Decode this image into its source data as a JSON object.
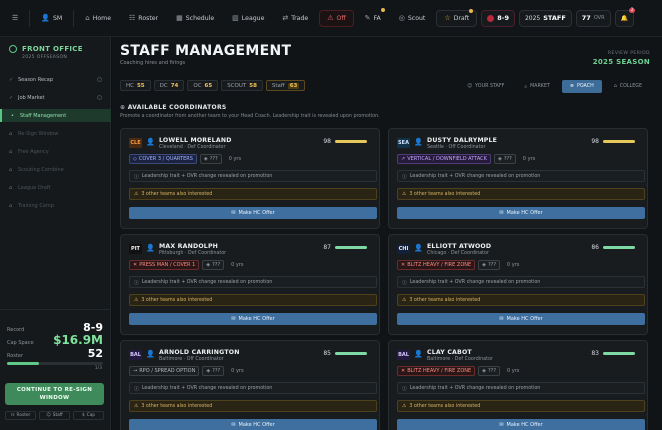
{
  "nav": {
    "user": "SM",
    "home": "Home",
    "roster": "Roster",
    "schedule": "Schedule",
    "league": "League",
    "trade": "Trade",
    "off": "Off",
    "fa": "FA",
    "scout": "Scout",
    "draft": "Draft",
    "record": "8-9",
    "staff_year": "2025",
    "staff_label": "STAFF",
    "ovr_value": "77",
    "ovr_label": "OVR",
    "notif_count": "2"
  },
  "sidebar": {
    "title": "FRONT OFFICE",
    "subtitle": "2025 OFFSEASON",
    "items": [
      {
        "label": "Season Recap"
      },
      {
        "label": "Job Market"
      },
      {
        "label": "Staff Management"
      },
      {
        "label": "Re-Sign Window"
      },
      {
        "label": "Free Agency"
      },
      {
        "label": "Scouting Combine"
      },
      {
        "label": "League Draft"
      },
      {
        "label": "Training Camp"
      }
    ],
    "record_label": "Record",
    "record_value": "8-9",
    "cap_label": "Cap Space",
    "cap_value": "$16.9M",
    "roster_label": "Roster",
    "roster_value": "52",
    "roster_progress": 0.33,
    "roster_frac": "1/3",
    "continue_line1": "CONTINUE TO RE-SIGN",
    "continue_line2": "WINDOW",
    "mini": [
      "Roster",
      "Staff",
      "Cap"
    ]
  },
  "header": {
    "title": "STAFF MANAGEMENT",
    "subtitle": "Coaching hires and firings",
    "review_label": "REVIEW PERIOD",
    "review_value": "2025 SEASON"
  },
  "chips": {
    "hc_label": "HC",
    "hc_value": "55",
    "dc_label": "DC",
    "dc_value": "74",
    "oc_label": "OC",
    "oc_value": "65",
    "scout_label": "SCOUT",
    "scout_value": "58",
    "staff_label": "Staff",
    "staff_value": "63"
  },
  "tabs": {
    "your_staff": "YOUR STAFF",
    "market": "MARKET",
    "poach": "POACH",
    "college": "COLLEGE"
  },
  "section": {
    "title": "AVAILABLE COORDINATORS",
    "subtitle": "Promote a coordinator from another team to your Head Coach. Leadership trait is revealed upon promotion."
  },
  "card_common": {
    "trait": "???",
    "exp": "0 yrs",
    "info": "Leadership trait + OVR change revealed on promotion",
    "warn": "3 other teams also interested",
    "offer": "Make HC Offer"
  },
  "coordinators": [
    {
      "team": "CLE",
      "name": "LOWELL MORELAND",
      "role": "Cleveland · Def Coordinator",
      "ovr": "98",
      "scheme": "COVER 3 / QUARTERS",
      "team_bg": "#4a2a10",
      "team_fg": "#ff9b3d",
      "bar": "#e6c85a"
    },
    {
      "team": "SEA",
      "name": "DUSTY DALRYMPLE",
      "role": "Seattle · Off Coordinator",
      "ovr": "98",
      "scheme": "VERTICAL / DOWNFIELD ATTACK",
      "team_bg": "#12324a",
      "team_fg": "#cfe7ff",
      "bar": "#e6c85a"
    },
    {
      "team": "PIT",
      "name": "MAX RANDOLPH",
      "role": "Pittsburgh · Def Coordinator",
      "ovr": "87",
      "scheme": "PRESS MAN / COVER 1",
      "team_bg": "#111111",
      "team_fg": "#f2f2f2",
      "bar": "#7fd9a4"
    },
    {
      "team": "CHI",
      "name": "ELLIOTT ATWOOD",
      "role": "Chicago · Def Coordinator",
      "ovr": "86",
      "scheme": "BLITZ HEAVY / FIRE ZONE",
      "team_bg": "#13203a",
      "team_fg": "#e9eefc",
      "bar": "#7fd9a4"
    },
    {
      "team": "BAL",
      "name": "ARNOLD CARRINGTON",
      "role": "Baltimore · Off Coordinator",
      "ovr": "85",
      "scheme": "RPO / SPREAD OPTION",
      "team_bg": "#231a3f",
      "team_fg": "#d8c9ff",
      "bar": "#7fd9a4"
    },
    {
      "team": "BAL",
      "name": "CLAY CABOT",
      "role": "Baltimore · Def Coordinator",
      "ovr": "83",
      "scheme": "BLITZ HEAVY / FIRE ZONE",
      "team_bg": "#231a3f",
      "team_fg": "#d8c9ff",
      "bar": "#7fd9a4"
    }
  ]
}
